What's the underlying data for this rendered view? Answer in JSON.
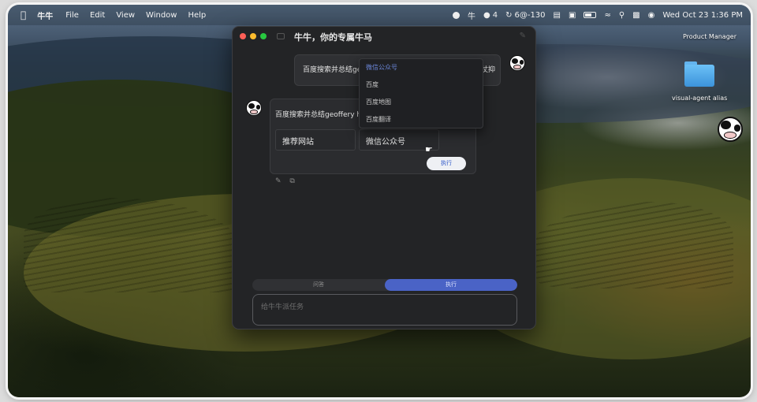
{
  "menubar": {
    "apple": "",
    "app_name": "牛牛",
    "menus": [
      "File",
      "Edit",
      "View",
      "Window",
      "Help"
    ],
    "status_items": [
      "4",
      "6@-130"
    ],
    "clock": "Wed Oct 23  1:36 PM"
  },
  "desktop": {
    "top_label": "Product Manager",
    "folder_label": "visual-agent alias"
  },
  "window": {
    "title": "牛牛，你的专属牛马"
  },
  "chat": {
    "user_message": "百度搜索并总结geoffery hinton的成就",
    "user_message_tail": "仗抑",
    "bot_message": "百度搜索并总结geoffery hinton的成就，推荐两个来源",
    "bot_message_tail": "r",
    "options": [
      "推荐网站",
      "微信公众号"
    ],
    "run_button": "执行"
  },
  "dropdown": {
    "items": [
      "微信公众号",
      "百度",
      "百度地图",
      "百度翻译"
    ],
    "selected": "微信公众号"
  },
  "modes": {
    "left": "问答",
    "right": "执行"
  },
  "task_input": {
    "placeholder": "给牛牛派任务"
  }
}
